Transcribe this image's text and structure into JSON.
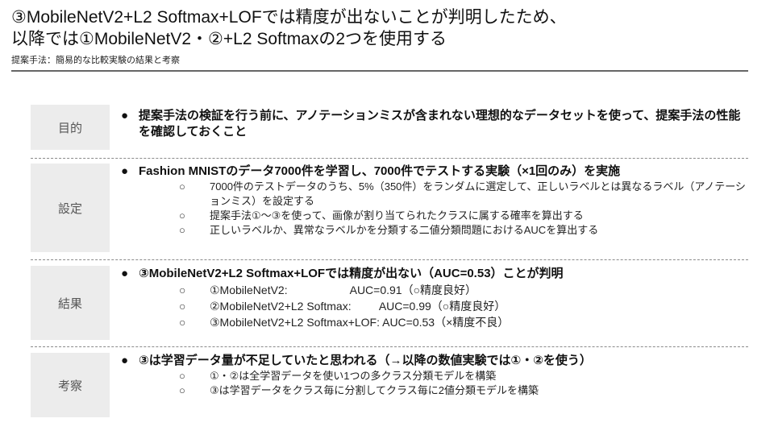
{
  "header": {
    "title_line1": "③MobileNetV2+L2 Softmax+LOFでは精度が出ないことが判明したため、",
    "title_line2": "以降では①MobileNetV2・②+L2 Softmaxの2つを使用する",
    "subtitle": "提案手法：簡易的な比較実験の結果と考察"
  },
  "bullet_symbol": "●",
  "sub_symbol": "○",
  "sections": [
    {
      "label": "目的",
      "main": "提案手法の検証を行う前に、アノテーションミスが含まれない理想的なデータセットを使って、提案手法の性能を確認しておくこと",
      "subs": []
    },
    {
      "label": "設定",
      "main": "Fashion MNISTのデータ7000件を学習し、7000件でテストする実験（×1回のみ）を実施",
      "subs": [
        "7000件のテストデータのうち、5%（350件）をランダムに選定して、正しいラベルとは異なるラベル（アノテーションミス）を設定する",
        "提案手法①〜③を使って、画像が割り当てられたクラスに属する確率を算出する",
        "正しいラベルか、異常なラベルかを分類する二値分類問題におけるAUCを算出する"
      ]
    },
    {
      "label": "結果",
      "main": "③MobileNetV2+L2 Softmax+LOFでは精度が出ない（AUC=0.53）ことが判明",
      "subs": [
        "①MobileNetV2:                    AUC=0.91（○精度良好）",
        "②MobileNetV2+L2 Softmax:         AUC=0.99（○精度良好）",
        "③MobileNetV2+L2 Softmax+LOF: AUC=0.53（×精度不良）"
      ]
    },
    {
      "label": "考察",
      "main": "③は学習データ量が不足していたと思われる（→以降の数値実験では①・②を使う）",
      "subs": [
        "①・②は全学習データを使い1つの多クラス分類モデルを構築",
        "③は学習データをクラス毎に分割してクラス毎に2値分類モデルを構築"
      ]
    }
  ]
}
